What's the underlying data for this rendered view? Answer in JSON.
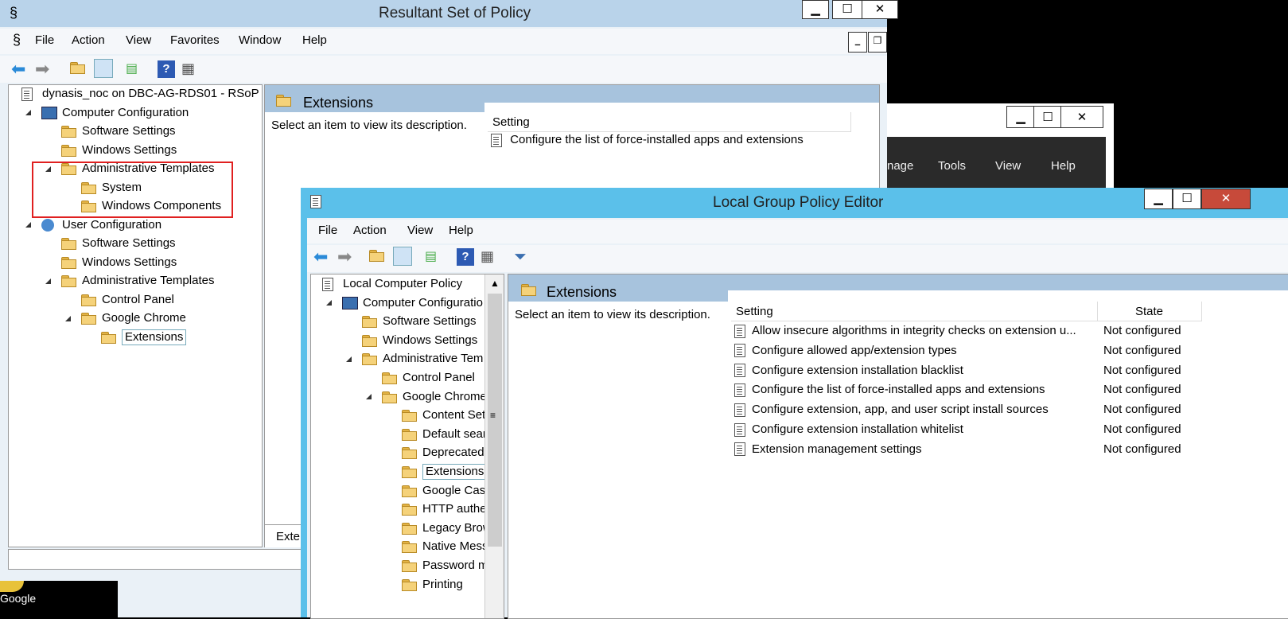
{
  "rsop": {
    "title": "Resultant Set of Policy",
    "menu": [
      "File",
      "Action",
      "View",
      "Favorites",
      "Window",
      "Help"
    ],
    "tree": [
      {
        "label": "dynasis_noc on DBC-AG-RDS01 - RSoP",
        "level": 0,
        "exp": "",
        "icon": "doc"
      },
      {
        "label": "Computer Configuration",
        "level": 1,
        "exp": "open",
        "icon": "computer"
      },
      {
        "label": "Software Settings",
        "level": 2,
        "exp": "closed",
        "icon": "folder"
      },
      {
        "label": "Windows Settings",
        "level": 2,
        "exp": "closed",
        "icon": "folder"
      },
      {
        "label": "Administrative Templates",
        "level": 2,
        "exp": "open",
        "icon": "folder"
      },
      {
        "label": "System",
        "level": 3,
        "exp": "closed",
        "icon": "folder"
      },
      {
        "label": "Windows Components",
        "level": 3,
        "exp": "closed",
        "icon": "folder"
      },
      {
        "label": "User Configuration",
        "level": 1,
        "exp": "open",
        "icon": "user"
      },
      {
        "label": "Software Settings",
        "level": 2,
        "exp": "closed",
        "icon": "folder"
      },
      {
        "label": "Windows Settings",
        "level": 2,
        "exp": "closed",
        "icon": "folder"
      },
      {
        "label": "Administrative Templates",
        "level": 2,
        "exp": "open",
        "icon": "folder"
      },
      {
        "label": "Control Panel",
        "level": 3,
        "exp": "closed",
        "icon": "folder"
      },
      {
        "label": "Google Chrome",
        "level": 3,
        "exp": "open",
        "icon": "folder"
      },
      {
        "label": "Extensions",
        "level": 4,
        "exp": "",
        "icon": "folder",
        "selected": true
      }
    ],
    "panel_title": "Extensions",
    "description": "Select an item to view its description.",
    "column_setting": "Setting",
    "rows": [
      "Configure the list of force-installed apps and extensions"
    ],
    "bottom_tab": "Exten"
  },
  "bg_window": {
    "menu": [
      "nage",
      "Tools",
      "View",
      "Help"
    ]
  },
  "lgpe": {
    "title": "Local Group Policy Editor",
    "menu": [
      "File",
      "Action",
      "View",
      "Help"
    ],
    "tree": [
      {
        "label": "Local Computer Policy",
        "level": 0,
        "exp": "",
        "icon": "doc"
      },
      {
        "label": "Computer Configuratio",
        "level": 1,
        "exp": "open",
        "icon": "computer"
      },
      {
        "label": "Software Settings",
        "level": 2,
        "exp": "closed",
        "icon": "folder"
      },
      {
        "label": "Windows Settings",
        "level": 2,
        "exp": "closed",
        "icon": "folder"
      },
      {
        "label": "Administrative Tem",
        "level": 2,
        "exp": "open",
        "icon": "folder"
      },
      {
        "label": "Control Panel",
        "level": 3,
        "exp": "closed",
        "icon": "folder"
      },
      {
        "label": "Google Chrome",
        "level": 3,
        "exp": "open",
        "icon": "folder"
      },
      {
        "label": "Content Sett",
        "level": 4,
        "exp": "",
        "icon": "folder"
      },
      {
        "label": "Default searc",
        "level": 4,
        "exp": "",
        "icon": "folder"
      },
      {
        "label": "Deprecated p",
        "level": 4,
        "exp": "",
        "icon": "folder"
      },
      {
        "label": "Extensions",
        "level": 4,
        "exp": "",
        "icon": "folder",
        "selected": true
      },
      {
        "label": "Google Cast",
        "level": 4,
        "exp": "",
        "icon": "folder"
      },
      {
        "label": "HTTP auther",
        "level": 4,
        "exp": "",
        "icon": "folder"
      },
      {
        "label": "Legacy Brow",
        "level": 4,
        "exp": "",
        "icon": "folder"
      },
      {
        "label": "Native Messa",
        "level": 4,
        "exp": "",
        "icon": "folder"
      },
      {
        "label": "Password ma",
        "level": 4,
        "exp": "",
        "icon": "folder"
      },
      {
        "label": "Printing",
        "level": 4,
        "exp": "",
        "icon": "folder"
      }
    ],
    "panel_title": "Extensions",
    "description": "Select an item to view its description.",
    "column_setting": "Setting",
    "column_state": "State",
    "rows": [
      {
        "setting": "Allow insecure algorithms in integrity checks on extension u...",
        "state": "Not configured"
      },
      {
        "setting": "Configure allowed app/extension types",
        "state": "Not configured"
      },
      {
        "setting": "Configure extension installation blacklist",
        "state": "Not configured"
      },
      {
        "setting": "Configure the list of force-installed apps and extensions",
        "state": "Not configured"
      },
      {
        "setting": "Configure extension, app, and user script install sources",
        "state": "Not configured"
      },
      {
        "setting": "Configure extension installation whitelist",
        "state": "Not configured"
      },
      {
        "setting": "Extension management settings",
        "state": "Not configured"
      }
    ]
  },
  "taskbar": {
    "label": "Google"
  }
}
